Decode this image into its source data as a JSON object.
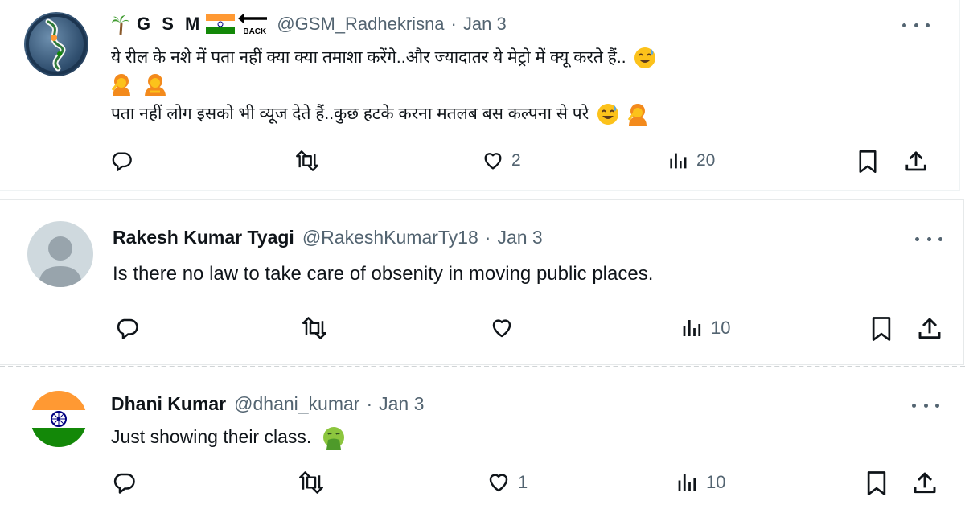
{
  "tweets": [
    {
      "display_name": "G S M",
      "handle": "@GSM_Radhekrisna",
      "separator": "·",
      "date": "Jan 3",
      "badge_text": "BACK",
      "line1": "ये रील के नशे में पता नहीं क्या क्या तमाशा करेंगे..और ज्यादातर ये मेट्रो में क्यू करते हैं..",
      "line2": "पता नहीं लोग इसको भी व्यूज देते हैं..कुछ हटके करना मतलब बस कल्पना से परे",
      "likes": "2",
      "views": "20"
    },
    {
      "display_name": "Rakesh Kumar Tyagi",
      "handle": "@RakeshKumarTy18",
      "separator": "·",
      "date": "Jan 3",
      "text": "Is there no law to take care of obsenity in moving public places.",
      "likes": "",
      "views": "10"
    },
    {
      "display_name": "Dhani Kumar",
      "handle": "@dhani_kumar",
      "separator": "·",
      "date": "Jan 3",
      "text": "Just showing their class.",
      "likes": "1",
      "views": "10"
    }
  ],
  "icons": {
    "reply": "reply-icon",
    "retweet": "retweet-icon",
    "like": "heart-icon",
    "views": "views-icon",
    "bookmark": "bookmark-icon",
    "share": "share-icon",
    "more": "more-icon"
  },
  "colors": {
    "text": "#0f1419",
    "muted": "#536471",
    "india_saffron": "#ff9933",
    "india_green": "#138808",
    "chakra": "#000080"
  }
}
